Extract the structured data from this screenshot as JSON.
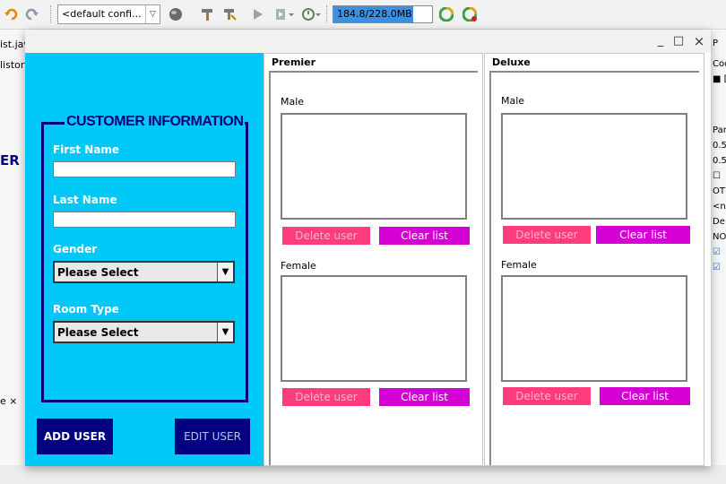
{
  "ide": {
    "config_select_value": "<default confi...",
    "memory_usage": "184.8/228.0MB",
    "memory_fraction": 0.81,
    "left_fragments": [
      "ist.jav",
      "listory",
      "ER IN",
      "e ×"
    ],
    "right_fragments": [
      "P",
      "Cod",
      "■ [",
      "Par",
      "0.5",
      "0.5",
      "☐",
      "OT",
      "<n",
      "De",
      "NO",
      "☑",
      "☑"
    ]
  },
  "window": {
    "minimize_glyph": "_",
    "maximize_glyph": "□",
    "close_glyph": "×"
  },
  "customer": {
    "section_title": "CUSTOMER INFORMATION",
    "first_name_label": "First Name",
    "first_name_value": "",
    "last_name_label": "Last Name",
    "last_name_value": "",
    "gender_label": "Gender",
    "gender_value": "Please Select",
    "room_type_label": "Room Type",
    "room_type_value": "Please Select",
    "add_user_label": "ADD USER",
    "edit_user_label": "EDIT USER"
  },
  "rooms": [
    {
      "title": "Premier",
      "male_label": "Male",
      "female_label": "Female",
      "delete_label": "Delete user",
      "clear_label": "Clear list"
    },
    {
      "title": "Deluxe",
      "male_label": "Male",
      "female_label": "Female",
      "delete_label": "Delete user",
      "clear_label": "Clear list"
    }
  ],
  "colors": {
    "panel_blue": "#00c8f6",
    "navy": "#000080",
    "delete_pink": "#ff3d7d",
    "clear_magenta": "#d400d4",
    "memory_blue": "#3d8fe0"
  }
}
